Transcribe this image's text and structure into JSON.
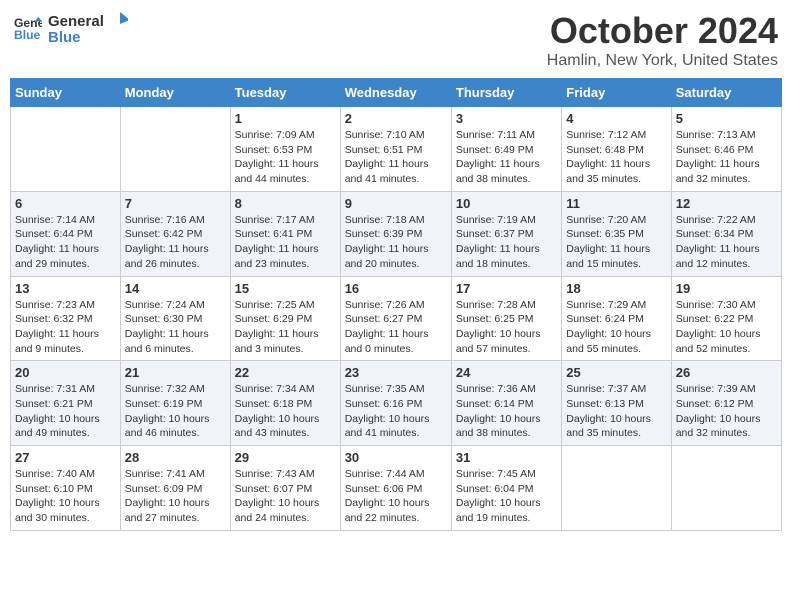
{
  "header": {
    "logo_line1": "General",
    "logo_line2": "Blue",
    "month": "October 2024",
    "location": "Hamlin, New York, United States"
  },
  "days_of_week": [
    "Sunday",
    "Monday",
    "Tuesday",
    "Wednesday",
    "Thursday",
    "Friday",
    "Saturday"
  ],
  "weeks": [
    [
      {
        "day": "",
        "info": ""
      },
      {
        "day": "",
        "info": ""
      },
      {
        "day": "1",
        "info": "Sunrise: 7:09 AM\nSunset: 6:53 PM\nDaylight: 11 hours and 44 minutes."
      },
      {
        "day": "2",
        "info": "Sunrise: 7:10 AM\nSunset: 6:51 PM\nDaylight: 11 hours and 41 minutes."
      },
      {
        "day": "3",
        "info": "Sunrise: 7:11 AM\nSunset: 6:49 PM\nDaylight: 11 hours and 38 minutes."
      },
      {
        "day": "4",
        "info": "Sunrise: 7:12 AM\nSunset: 6:48 PM\nDaylight: 11 hours and 35 minutes."
      },
      {
        "day": "5",
        "info": "Sunrise: 7:13 AM\nSunset: 6:46 PM\nDaylight: 11 hours and 32 minutes."
      }
    ],
    [
      {
        "day": "6",
        "info": "Sunrise: 7:14 AM\nSunset: 6:44 PM\nDaylight: 11 hours and 29 minutes."
      },
      {
        "day": "7",
        "info": "Sunrise: 7:16 AM\nSunset: 6:42 PM\nDaylight: 11 hours and 26 minutes."
      },
      {
        "day": "8",
        "info": "Sunrise: 7:17 AM\nSunset: 6:41 PM\nDaylight: 11 hours and 23 minutes."
      },
      {
        "day": "9",
        "info": "Sunrise: 7:18 AM\nSunset: 6:39 PM\nDaylight: 11 hours and 20 minutes."
      },
      {
        "day": "10",
        "info": "Sunrise: 7:19 AM\nSunset: 6:37 PM\nDaylight: 11 hours and 18 minutes."
      },
      {
        "day": "11",
        "info": "Sunrise: 7:20 AM\nSunset: 6:35 PM\nDaylight: 11 hours and 15 minutes."
      },
      {
        "day": "12",
        "info": "Sunrise: 7:22 AM\nSunset: 6:34 PM\nDaylight: 11 hours and 12 minutes."
      }
    ],
    [
      {
        "day": "13",
        "info": "Sunrise: 7:23 AM\nSunset: 6:32 PM\nDaylight: 11 hours and 9 minutes."
      },
      {
        "day": "14",
        "info": "Sunrise: 7:24 AM\nSunset: 6:30 PM\nDaylight: 11 hours and 6 minutes."
      },
      {
        "day": "15",
        "info": "Sunrise: 7:25 AM\nSunset: 6:29 PM\nDaylight: 11 hours and 3 minutes."
      },
      {
        "day": "16",
        "info": "Sunrise: 7:26 AM\nSunset: 6:27 PM\nDaylight: 11 hours and 0 minutes."
      },
      {
        "day": "17",
        "info": "Sunrise: 7:28 AM\nSunset: 6:25 PM\nDaylight: 10 hours and 57 minutes."
      },
      {
        "day": "18",
        "info": "Sunrise: 7:29 AM\nSunset: 6:24 PM\nDaylight: 10 hours and 55 minutes."
      },
      {
        "day": "19",
        "info": "Sunrise: 7:30 AM\nSunset: 6:22 PM\nDaylight: 10 hours and 52 minutes."
      }
    ],
    [
      {
        "day": "20",
        "info": "Sunrise: 7:31 AM\nSunset: 6:21 PM\nDaylight: 10 hours and 49 minutes."
      },
      {
        "day": "21",
        "info": "Sunrise: 7:32 AM\nSunset: 6:19 PM\nDaylight: 10 hours and 46 minutes."
      },
      {
        "day": "22",
        "info": "Sunrise: 7:34 AM\nSunset: 6:18 PM\nDaylight: 10 hours and 43 minutes."
      },
      {
        "day": "23",
        "info": "Sunrise: 7:35 AM\nSunset: 6:16 PM\nDaylight: 10 hours and 41 minutes."
      },
      {
        "day": "24",
        "info": "Sunrise: 7:36 AM\nSunset: 6:14 PM\nDaylight: 10 hours and 38 minutes."
      },
      {
        "day": "25",
        "info": "Sunrise: 7:37 AM\nSunset: 6:13 PM\nDaylight: 10 hours and 35 minutes."
      },
      {
        "day": "26",
        "info": "Sunrise: 7:39 AM\nSunset: 6:12 PM\nDaylight: 10 hours and 32 minutes."
      }
    ],
    [
      {
        "day": "27",
        "info": "Sunrise: 7:40 AM\nSunset: 6:10 PM\nDaylight: 10 hours and 30 minutes."
      },
      {
        "day": "28",
        "info": "Sunrise: 7:41 AM\nSunset: 6:09 PM\nDaylight: 10 hours and 27 minutes."
      },
      {
        "day": "29",
        "info": "Sunrise: 7:43 AM\nSunset: 6:07 PM\nDaylight: 10 hours and 24 minutes."
      },
      {
        "day": "30",
        "info": "Sunrise: 7:44 AM\nSunset: 6:06 PM\nDaylight: 10 hours and 22 minutes."
      },
      {
        "day": "31",
        "info": "Sunrise: 7:45 AM\nSunset: 6:04 PM\nDaylight: 10 hours and 19 minutes."
      },
      {
        "day": "",
        "info": ""
      },
      {
        "day": "",
        "info": ""
      }
    ]
  ]
}
